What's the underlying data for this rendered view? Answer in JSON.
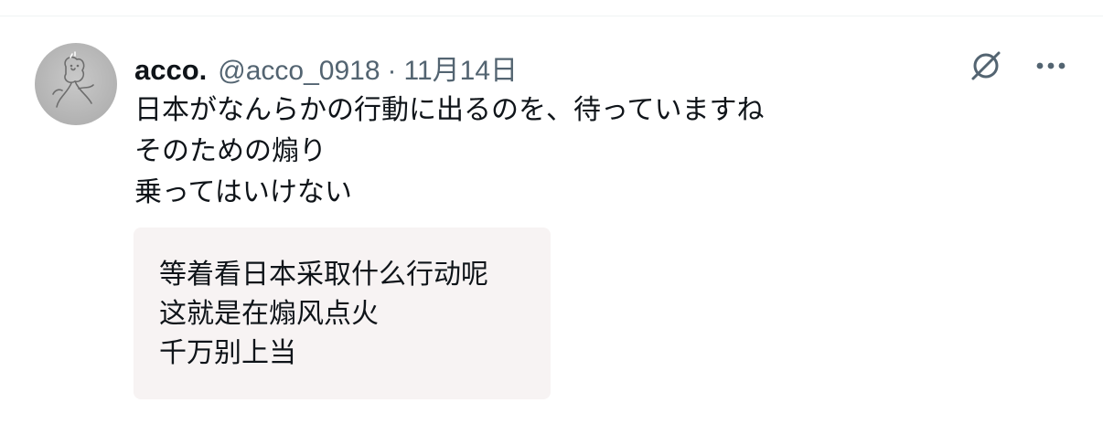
{
  "post": {
    "display_name": "acco.",
    "handle": "@acco_0918",
    "separator": "·",
    "date": "11月14日",
    "lines": [
      "日本がなんらかの行動に出るのを、待っていますね",
      "そのための煽り",
      "乗ってはいけない"
    ],
    "translation_lines": [
      "等着看日本采取什么行动呢",
      "这就是在煽风点火",
      "千万别上当"
    ]
  },
  "icons": {
    "avatar": "avatar-illustration",
    "slash": "slashed-circle-icon",
    "more": "more-options-icon"
  },
  "colors": {
    "text_primary": "#0f1419",
    "text_secondary": "#536471",
    "translation_bg": "#f7f3f3",
    "avatar_bg": "#b5b5b5"
  }
}
